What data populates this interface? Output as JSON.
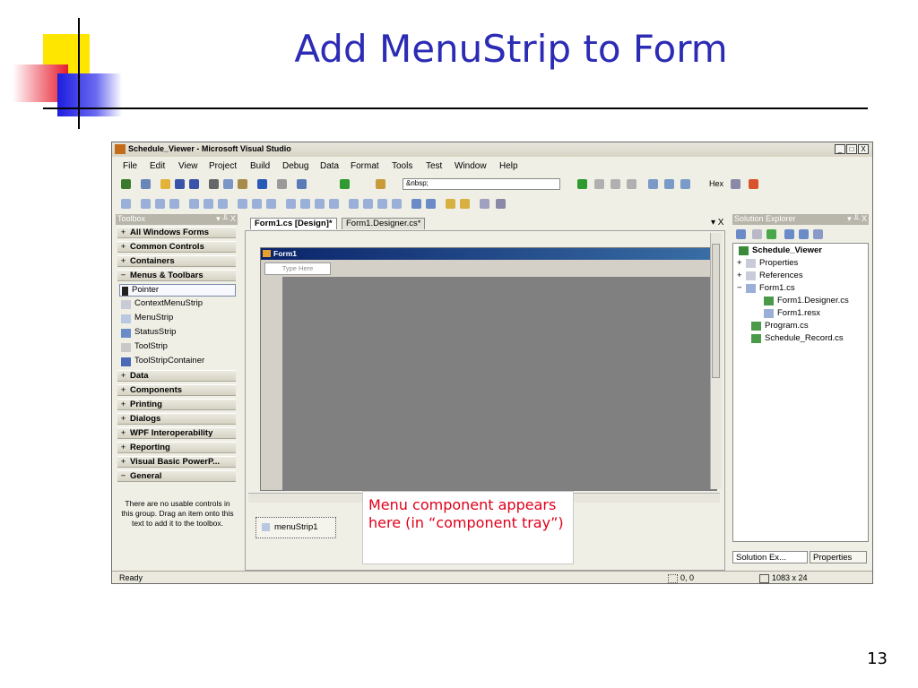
{
  "slide": {
    "title": "Add MenuStrip to Form",
    "page_number": "13"
  },
  "window": {
    "title": "Schedule_Viewer - Microsoft Visual Studio",
    "controls": [
      "_",
      "□",
      "X"
    ],
    "menu": [
      "File",
      "Edit",
      "View",
      "Project",
      "Build",
      "Debug",
      "Data",
      "Format",
      "Tools",
      "Test",
      "Window",
      "Help"
    ],
    "toolbar_combo_value": "&nbsp;",
    "toolbar_hex_label": "Hex"
  },
  "toolbox": {
    "title": "Toolbox",
    "pin": "▾ ╨ X",
    "categories_top": [
      {
        "sign": "+",
        "label": "All Windows Forms"
      },
      {
        "sign": "+",
        "label": "Common Controls"
      },
      {
        "sign": "+",
        "label": "Containers"
      },
      {
        "sign": "−",
        "label": "Menus & Toolbars"
      }
    ],
    "items": [
      "Pointer",
      "ContextMenuStrip",
      "MenuStrip",
      "StatusStrip",
      "ToolStrip",
      "ToolStripContainer"
    ],
    "categories_bottom": [
      {
        "sign": "+",
        "label": "Data"
      },
      {
        "sign": "+",
        "label": "Components"
      },
      {
        "sign": "+",
        "label": "Printing"
      },
      {
        "sign": "+",
        "label": "Dialogs"
      },
      {
        "sign": "+",
        "label": "WPF Interoperability"
      },
      {
        "sign": "+",
        "label": "Reporting"
      },
      {
        "sign": "+",
        "label": "Visual Basic PowerP..."
      },
      {
        "sign": "−",
        "label": "General"
      }
    ],
    "empty_note": "There are no usable controls in this group. Drag an item onto this text to add it to the toolbox."
  },
  "designer": {
    "tabs": [
      "Form1.cs [Design]*",
      "Form1.Designer.cs*"
    ],
    "tab_controls": "▾ X",
    "form_title": "Form1",
    "type_here": "Type Here",
    "tray_component": "menuStrip1"
  },
  "solution_explorer": {
    "title": "Solution Explorer",
    "pin": "▾ ╨ X",
    "project": "Schedule_Viewer",
    "nodes": [
      {
        "expander": "+",
        "label": "Properties",
        "level": 1
      },
      {
        "expander": "+",
        "label": "References",
        "level": 1
      },
      {
        "expander": "−",
        "label": "Form1.cs",
        "level": 1
      },
      {
        "expander": "",
        "label": "Form1.Designer.cs",
        "level": 2
      },
      {
        "expander": "",
        "label": "Form1.resx",
        "level": 2
      },
      {
        "expander": "",
        "label": "Program.cs",
        "level": 1
      },
      {
        "expander": "",
        "label": "Schedule_Record.cs",
        "level": 1
      }
    ],
    "bottom_tabs": [
      "Solution Ex...",
      "Properties"
    ]
  },
  "statusbar": {
    "text": "Ready",
    "position": "0, 0",
    "size": "1083 x 24"
  },
  "callout": {
    "text": "Menu component appears here (in “component tray”)"
  },
  "colors": {
    "title_blue": "#2b2bb5",
    "callout_red": "#e0001b",
    "form_titlebar": "#0a246a"
  }
}
